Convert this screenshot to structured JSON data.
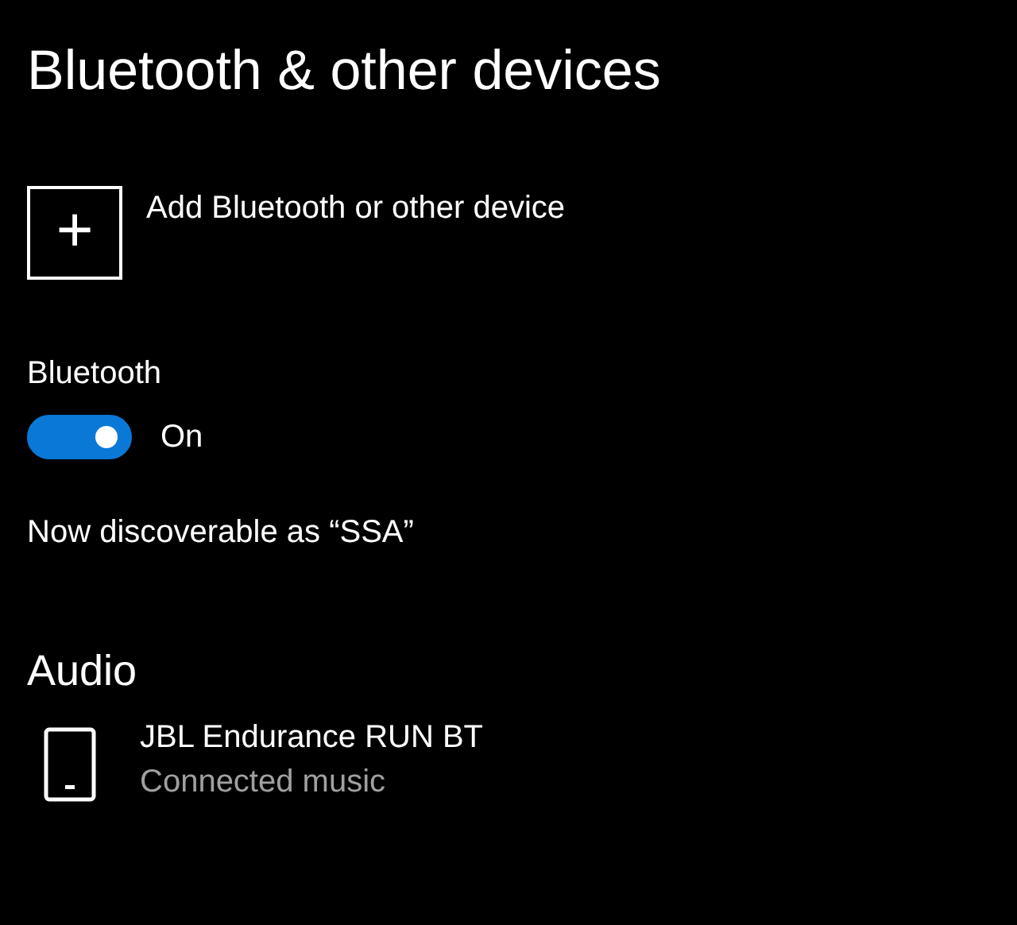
{
  "title": "Bluetooth & other devices",
  "add_device": {
    "label": "Add Bluetooth or other device",
    "icon": "+"
  },
  "bluetooth": {
    "label": "Bluetooth",
    "on": true,
    "state_text": "On"
  },
  "discoverable": "Now discoverable as “SSA”",
  "sections": [
    {
      "heading": "Audio",
      "devices": [
        {
          "name": "JBL Endurance RUN BT",
          "status": "Connected music"
        }
      ]
    }
  ]
}
